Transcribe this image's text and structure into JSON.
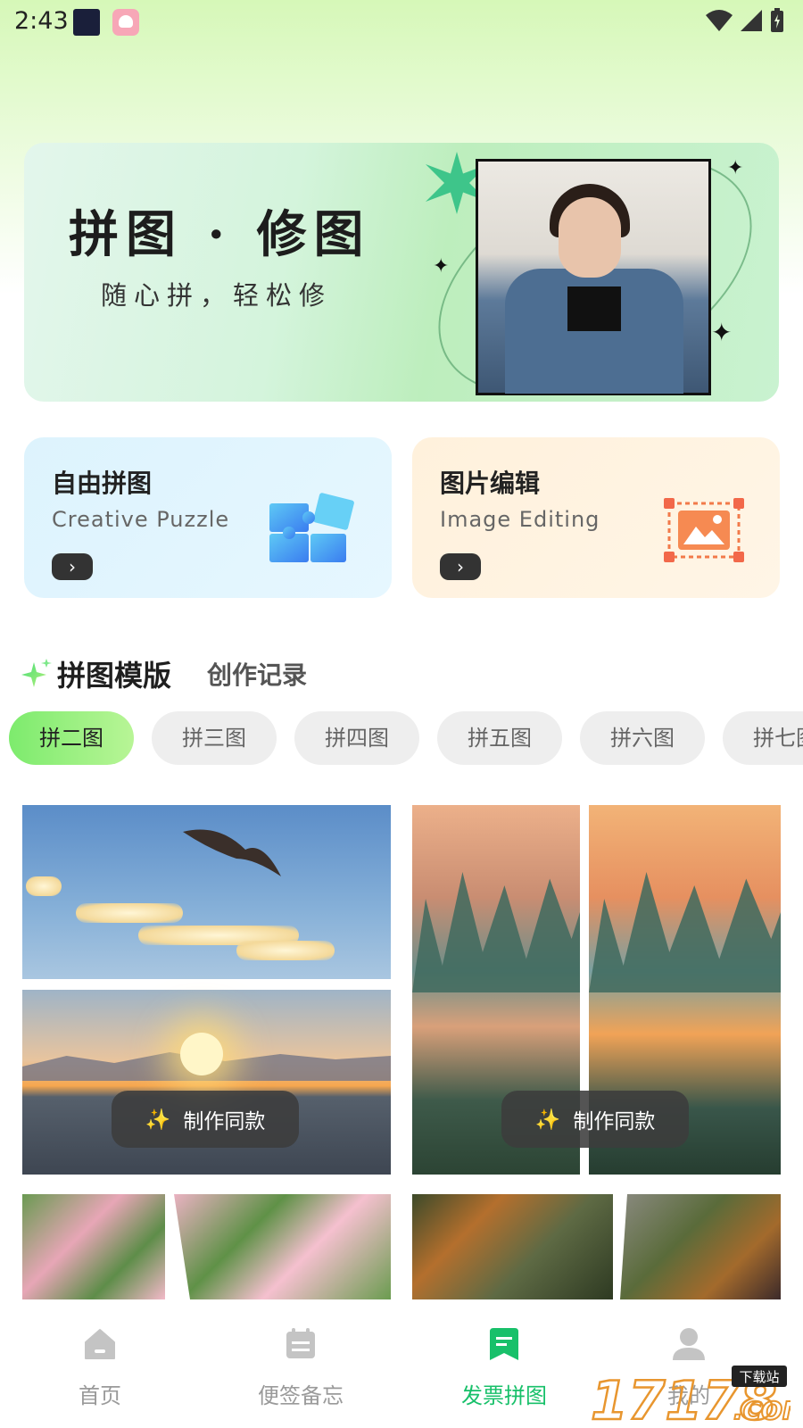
{
  "status_bar": {
    "time": "2:43"
  },
  "banner": {
    "title": "拼图 · 修图",
    "subtitle": "随心拼，轻松修"
  },
  "features": [
    {
      "title": "自由拼图",
      "subtitle": "Creative Puzzle",
      "icon": "puzzle-icon"
    },
    {
      "title": "图片编辑",
      "subtitle": "Image Editing",
      "icon": "image-edit-icon"
    }
  ],
  "sections": {
    "active": "拼图模版",
    "inactive": "创作记录"
  },
  "chips": [
    {
      "label": "拼二图",
      "active": true
    },
    {
      "label": "拼三图",
      "active": false
    },
    {
      "label": "拼四图",
      "active": false
    },
    {
      "label": "拼五图",
      "active": false
    },
    {
      "label": "拼六图",
      "active": false
    },
    {
      "label": "拼七图",
      "active": false
    }
  ],
  "templates": {
    "make_same_label": "制作同款"
  },
  "bottom_nav": [
    {
      "label": "首页",
      "icon": "home-icon",
      "active": false
    },
    {
      "label": "便签备忘",
      "icon": "notes-icon",
      "active": false
    },
    {
      "label": "发票拼图",
      "icon": "invoice-icon",
      "active": true
    },
    {
      "label": "我的",
      "icon": "profile-icon",
      "active": false
    }
  ],
  "watermark": {
    "text": "17178",
    "badge": "下载站",
    "suffix": ".COM"
  },
  "colors": {
    "accent_green": "#18c06a",
    "chip_active": "#7deb6d",
    "card_blue": "#ddf3fd",
    "card_orange": "#fff1dc"
  }
}
